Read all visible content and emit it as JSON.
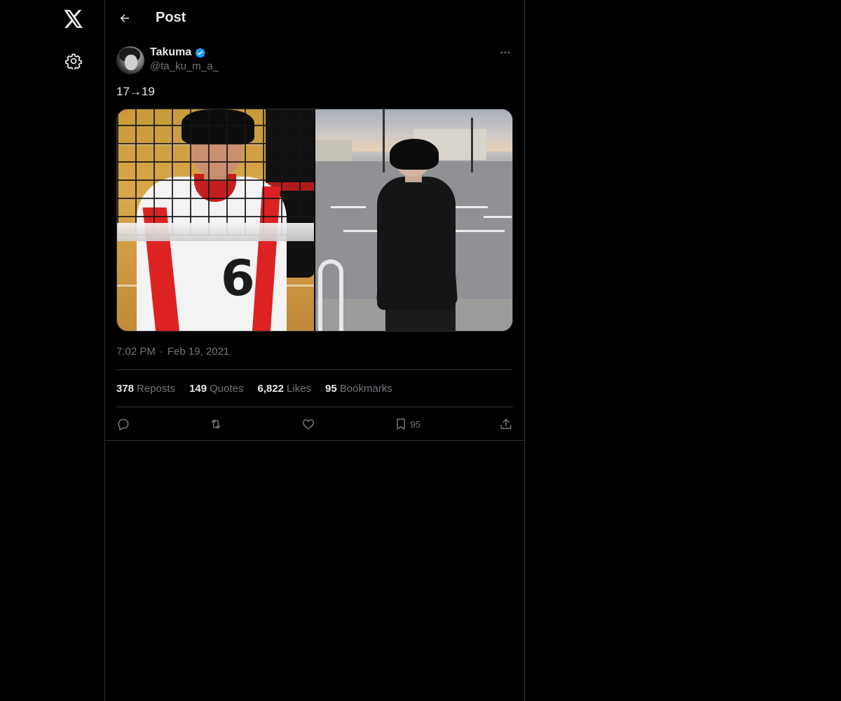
{
  "header": {
    "title": "Post"
  },
  "post": {
    "author_name": "Takuma",
    "author_handle": "@ta_ku_m_a_",
    "text": "17→19",
    "time": "7:02 PM",
    "separator": "·",
    "date": "Feb 19, 2021",
    "media": [
      {
        "number_on_jersey": "6"
      },
      {}
    ],
    "stats": [
      {
        "count": "378",
        "label": "Reposts"
      },
      {
        "count": "149",
        "label": "Quotes"
      },
      {
        "count": "6,822",
        "label": "Likes"
      },
      {
        "count": "95",
        "label": "Bookmarks"
      }
    ],
    "actions": {
      "bookmark_count": "95"
    }
  },
  "colors": {
    "background": "#000000",
    "border": "#2f3336",
    "text_primary": "#e7e9ea",
    "text_secondary": "#71767b",
    "verified_blue": "#1d9bf0"
  },
  "icons": {
    "logo": "x-logo-icon",
    "settings": "gear-icon",
    "back": "arrow-left-icon",
    "verified": "verified-badge-icon",
    "more": "more-horizontal-icon",
    "reply": "reply-icon",
    "repost": "repost-icon",
    "like": "heart-icon",
    "bookmark": "bookmark-icon",
    "share": "share-icon"
  }
}
